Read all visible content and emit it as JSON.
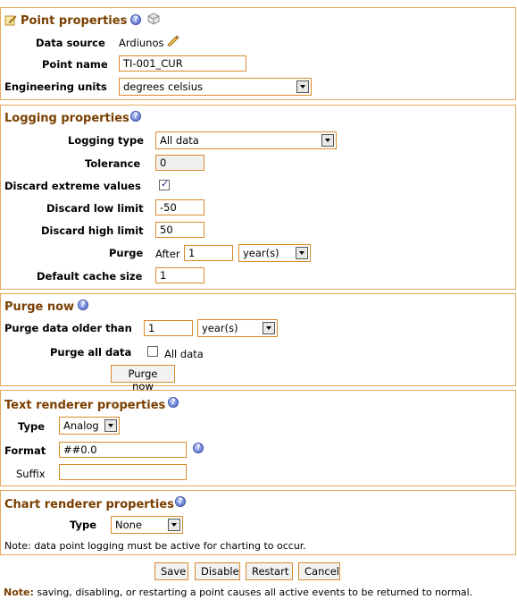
{
  "point_properties": {
    "title": "Point properties",
    "data_source_label": "Data source",
    "data_source_value": "Ardiunos",
    "point_name_label": "Point name",
    "point_name_value": "TI-001_CUR",
    "engineering_units_label": "Engineering units",
    "engineering_units_value": "degrees celsius"
  },
  "logging_properties": {
    "title": "Logging properties",
    "logging_type_label": "Logging type",
    "logging_type_value": "All data",
    "tolerance_label": "Tolerance",
    "tolerance_value": "0",
    "discard_extreme_label": "Discard extreme values",
    "discard_extreme_checked": true,
    "discard_low_label": "Discard low limit",
    "discard_low_value": "-50",
    "discard_high_label": "Discard high limit",
    "discard_high_value": "50",
    "purge_label": "Purge",
    "purge_after_text": "After",
    "purge_period_value": "1",
    "purge_period_unit": "year(s)",
    "default_cache_label": "Default cache size",
    "default_cache_value": "1"
  },
  "purge_now": {
    "title": "Purge now",
    "older_than_label": "Purge data older than",
    "older_than_value": "1",
    "older_than_unit": "year(s)",
    "purge_all_label": "Purge all data",
    "all_data_text": "All data",
    "purge_now_button": "Purge now"
  },
  "text_renderer": {
    "title": "Text renderer properties",
    "type_label": "Type",
    "type_value": "Analog",
    "format_label": "Format",
    "format_value": "##0.0",
    "suffix_label": "Suffix",
    "suffix_value": ""
  },
  "chart_renderer": {
    "title": "Chart renderer properties",
    "type_label": "Type",
    "type_value": "None",
    "note_text": "Note: data point logging must be active for charting to occur."
  },
  "actions": {
    "save": "Save",
    "disable": "Disable",
    "restart": "Restart",
    "cancel": "Cancel"
  },
  "footer_note": {
    "prefix": "Note:",
    "text": " saving, disabling, or restarting a point causes all active events to be returned to normal."
  },
  "colors": {
    "border": "#e6a95c",
    "title": "#7a3f00",
    "input_border": "#d88a2a"
  }
}
